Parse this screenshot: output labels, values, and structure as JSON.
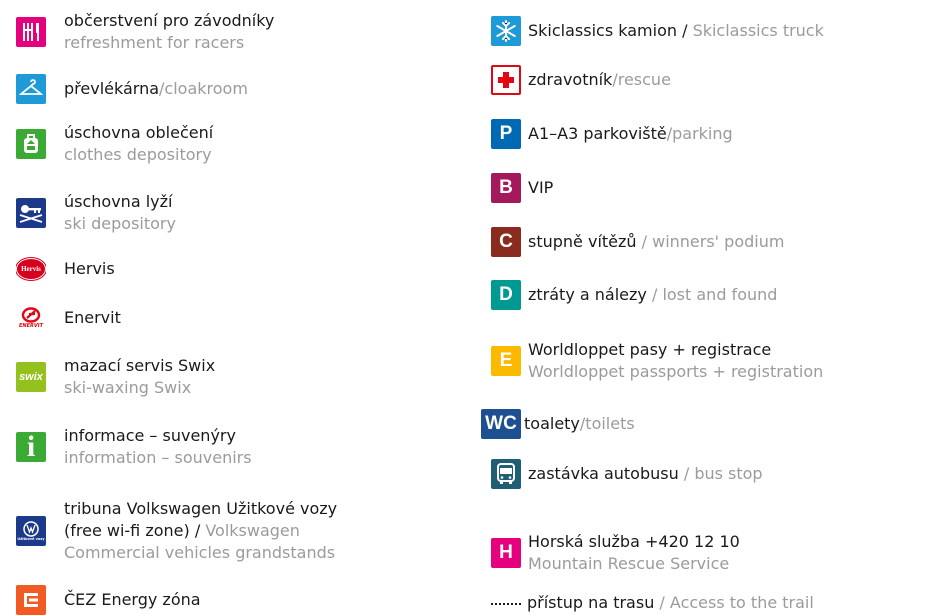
{
  "left": [
    {
      "cz": "občerstvení pro závodníky",
      "en": "refreshment for racers",
      "icon": "fork-knife-icon",
      "color": "#e5007e"
    },
    {
      "cz": "převlékárna",
      "en": "cloakroom",
      "sep": "/",
      "icon": "hanger-icon",
      "color": "#1e9ad6"
    },
    {
      "cz": "úschovna oblečení",
      "en": "clothes depository",
      "icon": "backpack-icon",
      "color": "#3aaa35"
    },
    {
      "cz": "úschovna lyží",
      "en": "ski depository",
      "icon": "ski-key-icon",
      "color": "#1d3a8a"
    },
    {
      "cz": "Hervis",
      "icon": "hervis-logo",
      "color": "#d6001c",
      "logo_text": "Hervis"
    },
    {
      "cz": "Enervit",
      "icon": "enervit-logo",
      "color": "#e30613",
      "logo_text": "ENERVIT"
    },
    {
      "cz": "mazací servis Swix",
      "en": "ski-waxing Swix",
      "icon": "swix-logo",
      "color": "#95c11f",
      "logo_text": "swix"
    },
    {
      "cz": "informace – suvenýry",
      "en": "information – souvenirs",
      "icon": "info-icon",
      "color": "#3aaa35",
      "logo_text": "i"
    },
    {
      "cz": "tribuna Volkswagen Užitkové vozy",
      "cz2": "(free wi-fi zone)",
      "en": "Volkswagen",
      "en2": "Commercial vehicles grandstands",
      "sep": " / ",
      "icon": "volkswagen-logo",
      "color": "#1d3a8a",
      "logo_text": "Užitkové vozy"
    },
    {
      "cz": "ČEZ Energy zóna",
      "icon": "cez-logo",
      "color": "#f15a22"
    }
  ],
  "right": [
    {
      "cz": "Skiclassics kamion",
      "en": "Skiclassics truck",
      "sep": " / ",
      "icon": "snowflake-icon",
      "color": "#1e9ad6"
    },
    {
      "cz": "zdravotník",
      "en": "rescue",
      "sep": "/",
      "icon": "red-cross-icon",
      "color": "#e30613"
    },
    {
      "cz": "A1–A3 parkoviště",
      "en": "parking",
      "sep": "/",
      "icon": "parking-icon",
      "color": "#0069b4",
      "letter": "P"
    },
    {
      "cz": "VIP",
      "icon": "letter-b-icon",
      "color": "#a3195b",
      "letter": "B"
    },
    {
      "cz": "stupně vítězů",
      "en": "winners' podium",
      "sep": " / ",
      "icon": "letter-c-icon",
      "color": "#8b2a1e",
      "letter": "C"
    },
    {
      "cz": "ztráty a nálezy",
      "en": "lost and found",
      "sep": " / ",
      "icon": "letter-d-icon",
      "color": "#009a93",
      "letter": "D"
    },
    {
      "cz": "Worldloppet pasy + registrace",
      "en": "Worldloppet passports + registration",
      "icon": "letter-e-icon",
      "color": "#fbb900",
      "letter": "E"
    },
    {
      "cz": "toalety",
      "en": "toilets",
      "sep": "/",
      "icon": "wc-icon",
      "color": "#1d4f91",
      "letter": "WC"
    },
    {
      "cz": "zastávka autobusu",
      "en": "bus stop",
      "sep": " / ",
      "icon": "bus-icon",
      "color": "#1f5f75"
    },
    {
      "cz": "Horská služba +420 12 10",
      "en": "Mountain Rescue Service",
      "icon": "letter-h-icon",
      "color": "#e5007e",
      "letter": "H"
    },
    {
      "cz": "přístup na trasu",
      "en": "Access to the trail",
      "sep": " / ",
      "icon": "dotted-line-icon",
      "color": "#1a1a1a"
    }
  ]
}
